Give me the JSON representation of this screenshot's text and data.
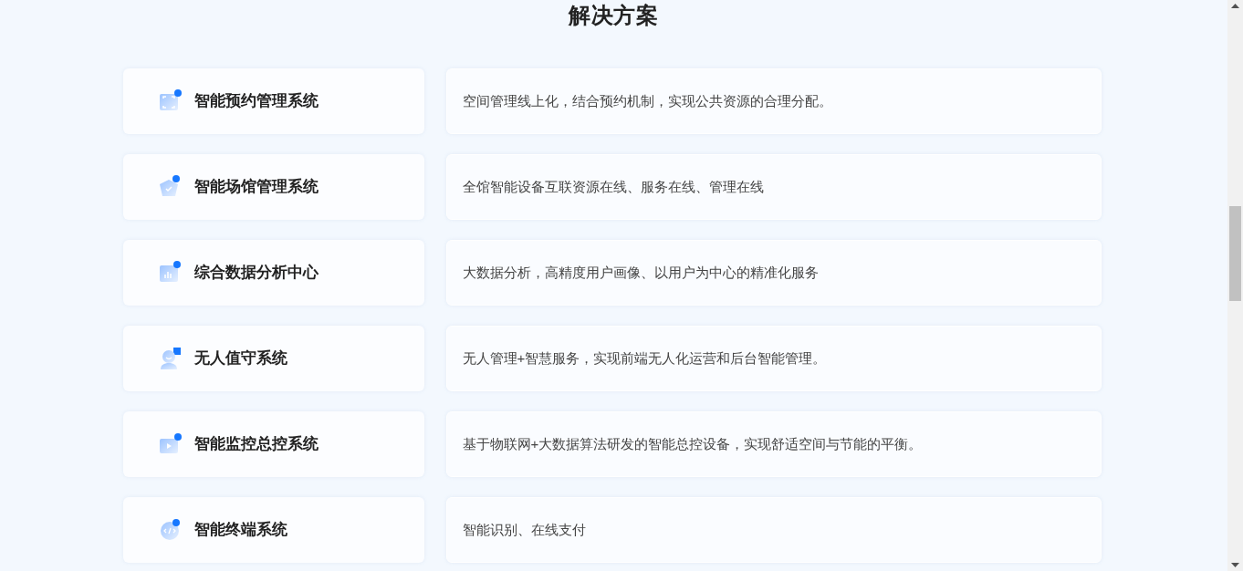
{
  "section_title": "解决方案",
  "solutions": [
    {
      "name": "智能预约管理系统",
      "description": "空间管理线上化，结合预约机制，实现公共资源的合理分配。"
    },
    {
      "name": "智能场馆管理系统",
      "description": "全馆智能设备互联资源在线、服务在线、管理在线"
    },
    {
      "name": "综合数据分析中心",
      "description": "大数据分析，高精度用户画像、以用户为中心的精准化服务"
    },
    {
      "name": "无人值守系统",
      "description": "无人管理+智慧服务，实现前端无人化运营和后台智能管理。"
    },
    {
      "name": "智能监控总控系统",
      "description": "基于物联网+大数据算法研发的智能总控设备，实现舒适空间与节能的平衡。"
    },
    {
      "name": "智能终端系统",
      "description": "智能识别、在线支付"
    }
  ]
}
